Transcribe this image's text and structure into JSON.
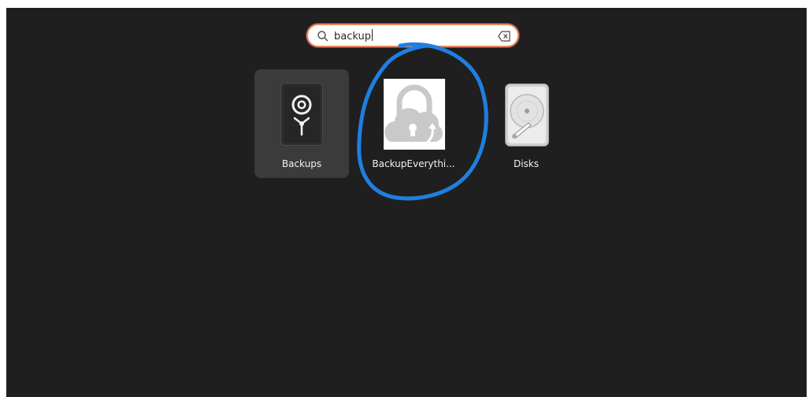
{
  "search": {
    "query": "backup",
    "search_icon": "search-icon",
    "clear_icon": "clear-text-icon"
  },
  "apps": [
    {
      "name": "Backups",
      "icon": "backups-vault-icon",
      "selected": true
    },
    {
      "name": "BackupEverythi...",
      "icon": "cloud-lock-icon",
      "selected": false
    },
    {
      "name": "Disks",
      "icon": "hard-disk-icon",
      "selected": false
    }
  ],
  "colors": {
    "background": "#1f1f1f",
    "selection": "#3b3b3b",
    "search_focus_ring": "#e9865f",
    "annotation_circle": "#1f7fe0"
  }
}
